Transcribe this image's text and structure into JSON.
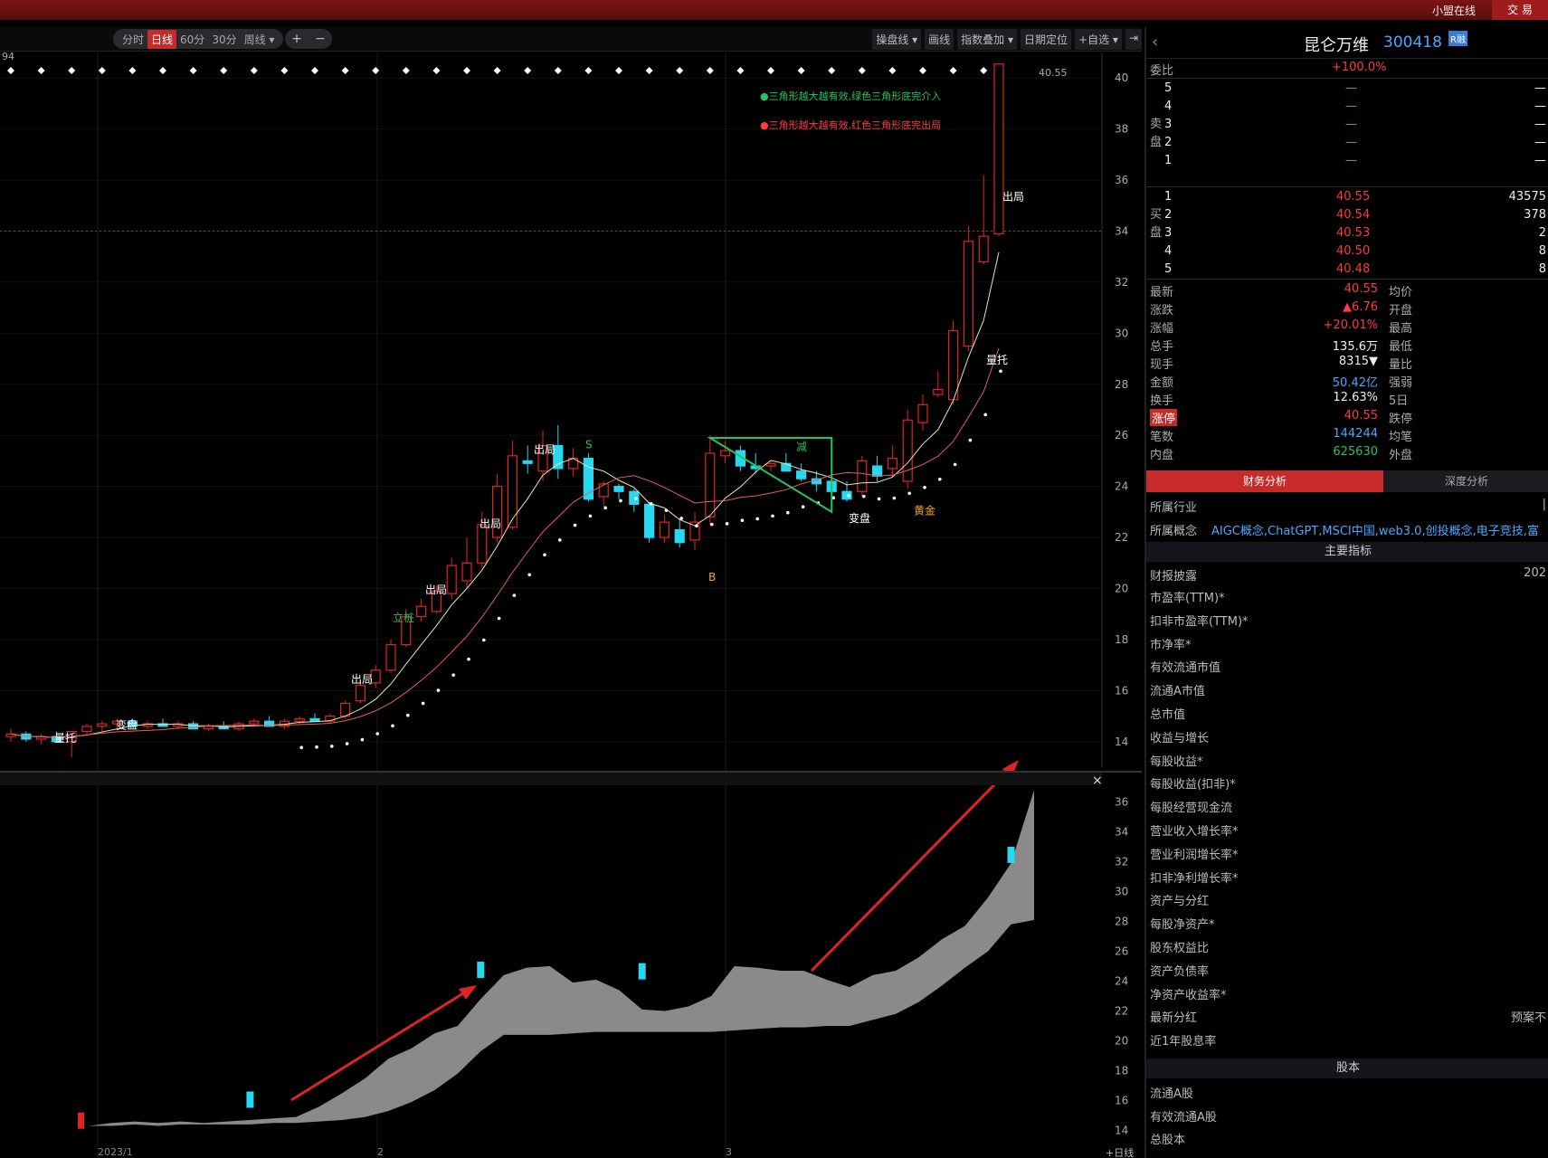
{
  "topbar": {
    "online": "小盟在线",
    "trade": "交 易"
  },
  "toolbar": {
    "periods": [
      "分时",
      "日线",
      "60分",
      "30分",
      "周线 ▾"
    ],
    "zoom_in": "+",
    "zoom_out": "−",
    "tools": [
      "操盘线 ▾",
      "画线",
      "指数叠加 ▾",
      "日期定位",
      "+自选 ▾"
    ],
    "collapse": "⇥"
  },
  "chart_data": [
    {
      "type": "candlestick",
      "title": "",
      "price_axis": {
        "range": [
          13,
          41
        ],
        "ticks": [
          "14",
          "16",
          "18",
          "20",
          "22",
          "24",
          "26",
          "28",
          "30",
          "32",
          "34",
          "36",
          "38",
          "40"
        ]
      },
      "max_label": "40.55",
      "top_left_label": "94",
      "legend": [
        {
          "text": "●三角形越大越有效,绿色三角形底完介入",
          "color": "#22c55e"
        },
        {
          "text": "●三角形越大越有效,红色三角形底完出局",
          "color": "#ff3b3b"
        }
      ],
      "candles": [
        [
          14.2,
          14.5,
          14.0,
          14.3
        ],
        [
          14.3,
          14.4,
          14.0,
          14.1
        ],
        [
          14.1,
          14.3,
          13.9,
          14.2
        ],
        [
          14.2,
          14.4,
          14.0,
          14.0
        ],
        [
          14.0,
          14.2,
          13.4,
          14.4
        ],
        [
          14.4,
          14.7,
          14.3,
          14.6
        ],
        [
          14.6,
          14.8,
          14.4,
          14.7
        ],
        [
          14.7,
          14.9,
          14.5,
          14.8
        ],
        [
          14.8,
          14.9,
          14.6,
          14.6
        ],
        [
          14.6,
          14.8,
          14.5,
          14.7
        ],
        [
          14.7,
          14.9,
          14.6,
          14.6
        ],
        [
          14.6,
          14.8,
          14.5,
          14.7
        ],
        [
          14.7,
          14.8,
          14.5,
          14.5
        ],
        [
          14.5,
          14.7,
          14.4,
          14.6
        ],
        [
          14.6,
          14.8,
          14.5,
          14.5
        ],
        [
          14.5,
          14.8,
          14.4,
          14.7
        ],
        [
          14.7,
          14.9,
          14.6,
          14.8
        ],
        [
          14.8,
          15.0,
          14.6,
          14.6
        ],
        [
          14.6,
          14.9,
          14.5,
          14.8
        ],
        [
          14.8,
          15.0,
          14.7,
          14.9
        ],
        [
          14.9,
          15.1,
          14.8,
          14.8
        ],
        [
          14.8,
          15.1,
          14.7,
          15.0
        ],
        [
          15.0,
          15.6,
          14.9,
          15.5
        ],
        [
          15.6,
          16.4,
          15.5,
          16.2
        ],
        [
          16.3,
          17.0,
          16.1,
          16.8
        ],
        [
          16.8,
          18.0,
          16.7,
          17.8
        ],
        [
          17.8,
          19.2,
          17.7,
          18.9
        ],
        [
          18.9,
          19.6,
          18.7,
          19.3
        ],
        [
          19.1,
          20.1,
          19.0,
          19.9
        ],
        [
          19.8,
          21.2,
          19.6,
          20.9
        ],
        [
          20.3,
          22.0,
          20.0,
          21.0
        ],
        [
          21.0,
          23.0,
          20.8,
          22.5
        ],
        [
          22.0,
          24.5,
          21.8,
          24.0
        ],
        [
          22.4,
          25.8,
          22.3,
          25.2
        ],
        [
          25.0,
          25.6,
          24.5,
          24.9
        ],
        [
          24.6,
          26.2,
          24.2,
          25.6
        ],
        [
          25.6,
          26.4,
          24.3,
          24.7
        ],
        [
          24.7,
          25.5,
          24.4,
          25.1
        ],
        [
          25.1,
          25.3,
          23.4,
          23.5
        ],
        [
          23.6,
          24.2,
          23.2,
          24.1
        ],
        [
          24.0,
          24.1,
          23.5,
          23.8
        ],
        [
          23.8,
          23.9,
          23.0,
          23.3
        ],
        [
          23.3,
          23.4,
          21.8,
          22.0
        ],
        [
          22.0,
          22.9,
          21.8,
          22.6
        ],
        [
          22.3,
          22.7,
          21.6,
          21.8
        ],
        [
          21.9,
          23.0,
          21.5,
          22.6
        ],
        [
          22.8,
          26.0,
          22.5,
          25.3
        ],
        [
          25.2,
          25.8,
          24.9,
          25.4
        ],
        [
          25.4,
          25.6,
          24.6,
          24.8
        ],
        [
          24.8,
          25.3,
          24.5,
          24.7
        ],
        [
          24.8,
          25.0,
          24.6,
          24.9
        ],
        [
          24.9,
          25.3,
          24.8,
          24.6
        ],
        [
          24.6,
          24.9,
          24.2,
          24.3
        ],
        [
          24.3,
          24.6,
          23.8,
          24.1
        ],
        [
          24.2,
          24.5,
          23.6,
          23.8
        ],
        [
          23.8,
          24.2,
          23.4,
          23.5
        ],
        [
          23.8,
          25.2,
          23.6,
          25.0
        ],
        [
          24.8,
          25.2,
          24.2,
          24.4
        ],
        [
          24.7,
          25.6,
          24.4,
          25.1
        ],
        [
          24.2,
          27.0,
          23.9,
          26.6
        ],
        [
          26.5,
          27.6,
          26.2,
          27.2
        ],
        [
          27.6,
          28.5,
          27.5,
          27.8
        ],
        [
          27.4,
          30.5,
          27.2,
          30.1
        ],
        [
          29.5,
          34.2,
          29.3,
          33.6
        ],
        [
          32.8,
          36.2,
          32.7,
          33.8
        ],
        [
          33.9,
          40.55,
          33.8,
          40.55
        ]
      ],
      "signals_text": [
        "量托",
        "变盘",
        "立桩",
        "出局",
        "出局",
        "出局",
        "出局",
        "S",
        "减",
        "B",
        "变盘",
        "黄金",
        "量托",
        "出局"
      ],
      "x_labels": [
        "2023/1",
        "2",
        "3"
      ]
    },
    {
      "type": "area",
      "title": "",
      "axis": {
        "range": [
          13,
          37
        ],
        "ticks": [
          "14",
          "16",
          "18",
          "20",
          "22",
          "24",
          "26",
          "28",
          "30",
          "32",
          "34",
          "36"
        ]
      },
      "upper": [
        14.3,
        14.5,
        14.6,
        14.5,
        14.6,
        14.5,
        14.6,
        14.7,
        14.8,
        14.9,
        15.6,
        16.5,
        17.5,
        18.8,
        19.5,
        20.5,
        21.0,
        22.8,
        24.4,
        24.9,
        25.0,
        23.9,
        24.1,
        23.4,
        22.1,
        22.0,
        22.3,
        23.0,
        25.0,
        24.9,
        24.7,
        24.7,
        24.1,
        23.6,
        24.4,
        24.7,
        25.6,
        26.8,
        27.7,
        29.6,
        31.9,
        36.8
      ],
      "lower": [
        14.3,
        14.3,
        14.4,
        14.3,
        14.4,
        14.4,
        14.4,
        14.4,
        14.5,
        14.5,
        14.6,
        14.7,
        14.9,
        15.3,
        15.9,
        16.7,
        17.8,
        19.3,
        20.4,
        20.4,
        20.4,
        20.5,
        20.6,
        20.6,
        20.6,
        20.6,
        20.6,
        20.6,
        20.7,
        20.8,
        20.9,
        20.9,
        21.0,
        21.0,
        21.4,
        21.8,
        22.6,
        23.7,
        24.9,
        26.0,
        27.8,
        28.1
      ]
    }
  ],
  "close_x": "×",
  "bottom_right_tab": "+日线",
  "panel": {
    "name": "昆仑万维",
    "code": "300418",
    "badge": "R融",
    "weibi_label": "委比",
    "weibi_value": "+100.0%",
    "sell_side": "卖盘",
    "buy_side": "买盘",
    "sell": [
      {
        "lvl": "5",
        "price": "—",
        "vol": "—"
      },
      {
        "lvl": "4",
        "price": "—",
        "vol": "—"
      },
      {
        "lvl": "3",
        "price": "—",
        "vol": "—"
      },
      {
        "lvl": "2",
        "price": "—",
        "vol": "—"
      },
      {
        "lvl": "1",
        "price": "—",
        "vol": "—"
      }
    ],
    "buy": [
      {
        "lvl": "1",
        "price": "40.55",
        "vol": "43575"
      },
      {
        "lvl": "2",
        "price": "40.54",
        "vol": "378"
      },
      {
        "lvl": "3",
        "price": "40.53",
        "vol": "2"
      },
      {
        "lvl": "4",
        "price": "40.50",
        "vol": "8"
      },
      {
        "lvl": "5",
        "price": "40.48",
        "vol": "8"
      }
    ],
    "quotes": [
      {
        "l": "最新",
        "v": "40.55",
        "c": "red",
        "r": "均价"
      },
      {
        "l": "涨跌",
        "v": "▲6.76",
        "c": "red",
        "r": "开盘"
      },
      {
        "l": "涨幅",
        "v": "+20.01%",
        "c": "red",
        "r": "最高"
      },
      {
        "l": "总手",
        "v": "135.6万",
        "c": "white",
        "r": "最低"
      },
      {
        "l": "现手",
        "v": "8315▼",
        "c": "white",
        "r": "量比"
      },
      {
        "l": "金额",
        "v": "50.42亿",
        "c": "blue",
        "r": "强弱"
      },
      {
        "l": "换手",
        "v": "12.63%",
        "c": "white",
        "r": "5日"
      },
      {
        "l": "涨停",
        "v": "40.55",
        "c": "red",
        "r": "跌停"
      },
      {
        "l": "笔数",
        "v": "144244",
        "c": "blue",
        "r": "均笔"
      },
      {
        "l": "内盘",
        "v": "625630",
        "c": "green",
        "r": "外盘"
      }
    ],
    "tab_finance": "财务分析",
    "tab_deep": "深度分析",
    "industry_label": "所属行业",
    "concept_label": "所属概念",
    "concept_value": "AIGC概念,ChatGPT,MSCI中国,web3.0,创投概念,电子竞技,富",
    "section_main": "主要指标",
    "report_label": "财报披露",
    "report_value": "202",
    "items": [
      "市盈率(TTM)*",
      "扣非市盈率(TTM)*",
      "市净率*",
      "有效流通市值",
      "流通A市值",
      "总市值",
      "收益与增长",
      "每股收益*",
      "每股收益(扣非)*",
      "每股经营现金流",
      "营业收入增长率*",
      "营业利润增长率*",
      "扣非净利增长率*",
      "资产与分红",
      "每股净资产*",
      "股东权益比",
      "资产负债率",
      "净资产收益率*",
      "最新分红",
      "近1年股息率"
    ],
    "dividend_value": "预案不",
    "section_shares": "股本",
    "share_items": [
      "流通A股",
      "有效流通A股",
      "总股本"
    ]
  },
  "colors": {
    "up": "#e02424",
    "down": "#28d7f0",
    "accent": "#c62a2a",
    "ma1": "#e8e6b0",
    "ma2": "#e06060"
  }
}
